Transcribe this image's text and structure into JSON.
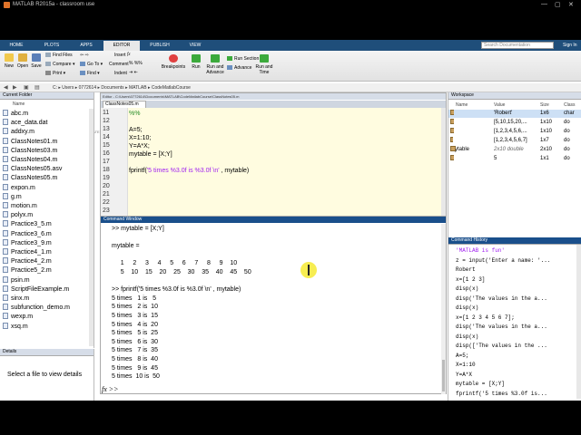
{
  "window": {
    "title": "MATLAB R2015a - classroom use"
  },
  "tabs": [
    "HOME",
    "PLOTS",
    "APPS",
    "EDITOR",
    "PUBLISH",
    "VIEW"
  ],
  "active_tab": "EDITOR",
  "search": {
    "placeholder": "Search Documentation"
  },
  "signin": "Sign In",
  "ribbon": {
    "file_group": {
      "new": "New",
      "open": "Open",
      "save": "Save",
      "find_files": "Find Files",
      "compare": "Compare",
      "print": "Print",
      "label": "FILE"
    },
    "navigate_group": {
      "go_to": "Go To",
      "find": "Find",
      "label": "NAVIGATE"
    },
    "edit_group": {
      "insert": "Insert",
      "comment": "Comment",
      "indent": "Indent",
      "label": "EDIT"
    },
    "breakpoints_group": {
      "breakpoints": "Breakpoints",
      "label": "BREAKPOINTS"
    },
    "run_group": {
      "run": "Run",
      "run_and_advance": "Run and Advance",
      "run_section": "Run Section",
      "advance": "Advance",
      "run_and_time": "Run and Time",
      "label": "RUN"
    }
  },
  "address": {
    "path": "C: ▸ Users ▸ 0772614 ▸ Documents ▸ MATLAB ▸ CodeMatlabCourse"
  },
  "current_folder": {
    "title": "Current Folder",
    "column": "Name",
    "files": [
      "abc.m",
      "ace_data.dat",
      "addxy.m",
      "ClassNotes01.m",
      "ClassNotes03.m",
      "ClassNotes04.m",
      "ClassNotes05.asv",
      "ClassNotes05.m",
      "expon.m",
      "g.m",
      "motion.m",
      "polyx.m",
      "Practice3_5.m",
      "Practice3_6.m",
      "Practice3_9.m",
      "Practice4_1.m",
      "Practice4_2.m",
      "Practice5_2.m",
      "psin.m",
      "ScriptFileExample.m",
      "sinx.m",
      "subfunction_demo.m",
      "wexp.m",
      "xsq.m"
    ]
  },
  "details": {
    "title": "Details",
    "message": "Select a file to view details"
  },
  "editor": {
    "title": "Editor - C:\\Users\\0772614\\Documents\\MATLAB\\CodeMatlabCourse\\ClassNotes05.m",
    "tab": "ClassNotes05.m",
    "lines": [
      {
        "n": "11",
        "code": "%%"
      },
      {
        "n": "12",
        "code": ""
      },
      {
        "n": "13",
        "code": "A=5;"
      },
      {
        "n": "14",
        "code": "X=1:10;"
      },
      {
        "n": "15",
        "code": "Y=A*X;"
      },
      {
        "n": "16",
        "code": "mytable = [X;Y]"
      },
      {
        "n": "17",
        "code": ""
      },
      {
        "n": "18",
        "code": "fprintf('5 times %3.0f is %3.0f \\n' , mytable)"
      },
      {
        "n": "19",
        "code": ""
      },
      {
        "n": "20",
        "code": ""
      },
      {
        "n": "21",
        "code": ""
      },
      {
        "n": "22",
        "code": ""
      },
      {
        "n": "23",
        "code": ""
      }
    ]
  },
  "command_window": {
    "title": "Command Window",
    "lines": [
      ">> mytable = [X;Y]",
      "",
      "mytable =",
      "",
      "     1     2     3     4     5     6     7     8     9    10",
      "     5    10    15    20    25    30    35    40    45    50",
      "",
      ">> fprintf('5 times %3.0f is %3.0f \\n' , mytable)",
      "5 times   1 is   5",
      "5 times   2 is  10",
      "5 times   3 is  15",
      "5 times   4 is  20",
      "5 times   5 is  25",
      "5 times   6 is  30",
      "5 times   7 is  35",
      "5 times   8 is  40",
      "5 times   9 is  45",
      "5 times  10 is  50"
    ],
    "prompt": "fx >>"
  },
  "workspace": {
    "title": "Workspace",
    "columns": [
      "Name",
      "Value",
      "Size",
      "Class"
    ],
    "rows": [
      {
        "name": "Z",
        "value": "'Robert'",
        "size": "1x6",
        "class": "char"
      },
      {
        "name": "Y",
        "value": "[5,10,15,20,...",
        "size": "1x10",
        "class": "do"
      },
      {
        "name": "X",
        "value": "[1,2,3,4,5,6,...",
        "size": "1x10",
        "class": "do"
      },
      {
        "name": "x",
        "value": "[1,2,3,4,5,6,7]",
        "size": "1x7",
        "class": "do"
      },
      {
        "name": "mytable",
        "value": "2x10 double",
        "size": "2x10",
        "class": "do"
      },
      {
        "name": "A",
        "value": "5",
        "size": "1x1",
        "class": "do"
      }
    ]
  },
  "history": {
    "title": "Command History",
    "lines": [
      "'MATLAB is fun'",
      "z = input('Enter a name: '...",
      "Robert",
      "x=[1 2 3]",
      "disp(x)",
      "disp('The values in the a...",
      "disp(x)",
      "x=[1 2 3 4 5 6 7];",
      "disp('The values in the a...",
      "disp(x)",
      "disp(['The values in the ...",
      "A=5;",
      "X=1:10",
      "Y=A*X",
      "mytable = [X;Y]",
      "fprintf('5 times %3.0f is..."
    ]
  },
  "colors": {
    "tabbar": "#1f4e7a",
    "command_title": "#1a4f8b",
    "string": "#a020f0",
    "comment": "#228b22",
    "cursor_highlight": "#f6ea35"
  }
}
